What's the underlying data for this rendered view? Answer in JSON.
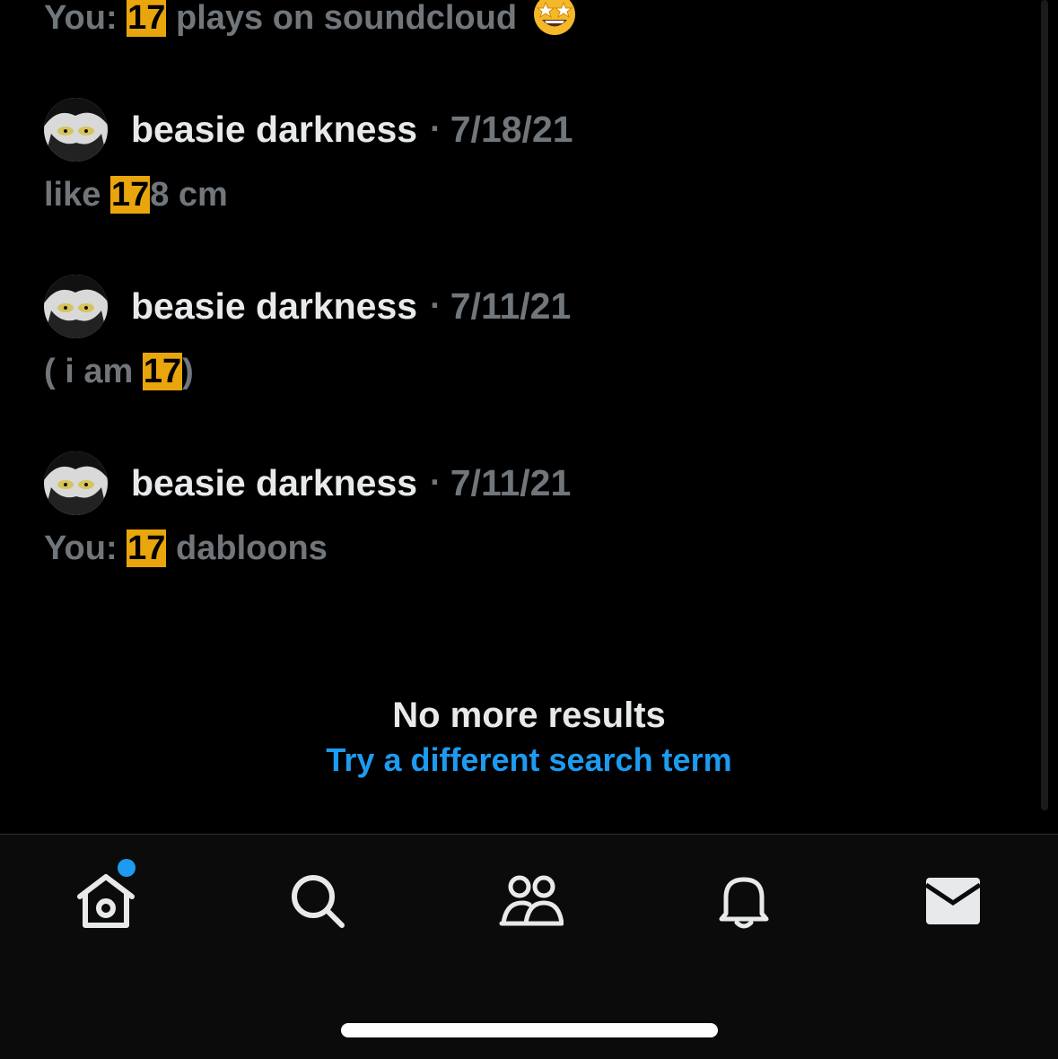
{
  "results": [
    {
      "snippet": {
        "prefix": "You: ",
        "match": "17",
        "suffix": " plays on soundcloud",
        "emoji": "star-struck-emoji"
      }
    },
    {
      "author": "beasie darkness",
      "separator": "·",
      "date": "7/18/21",
      "snippet": {
        "prefix": "like ",
        "match": "17",
        "suffix": "8 cm"
      }
    },
    {
      "author": "beasie darkness",
      "separator": "·",
      "date": "7/11/21",
      "snippet": {
        "prefix": "( i am ",
        "match": "17",
        "suffix": ")"
      }
    },
    {
      "author": "beasie darkness",
      "separator": "·",
      "date": "7/11/21",
      "snippet": {
        "prefix": "You: ",
        "match": "17",
        "suffix": " dabloons"
      }
    }
  ],
  "end_of_results": {
    "title": "No more results",
    "link": "Try a different search term"
  },
  "tabbar": {
    "tabs": [
      {
        "name": "home",
        "icon": "home-icon",
        "has_notification": true
      },
      {
        "name": "search",
        "icon": "search-icon",
        "has_notification": false
      },
      {
        "name": "communities",
        "icon": "people-icon",
        "has_notification": false
      },
      {
        "name": "notifications",
        "icon": "bell-icon",
        "has_notification": false
      },
      {
        "name": "messages",
        "icon": "mail-icon",
        "has_notification": false
      }
    ]
  },
  "colors": {
    "background": "#000000",
    "primary_text": "#e7e9ea",
    "secondary_text": "#71767b",
    "highlight": "#e8a50c",
    "link": "#1d9bf0",
    "notification_dot": "#1d9bf0"
  }
}
